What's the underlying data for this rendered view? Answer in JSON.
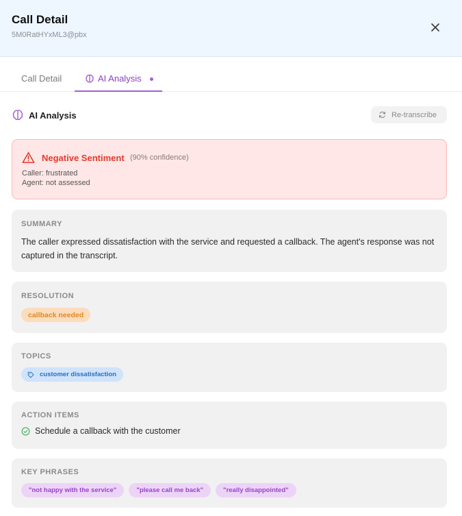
{
  "header": {
    "title": "Call Detail",
    "subtitle": "5M0RatHYxML3@pbx"
  },
  "tabs": [
    {
      "label": "Call Detail"
    },
    {
      "label": "AI Analysis"
    }
  ],
  "analysis": {
    "title": "AI Analysis",
    "retranscribe_label": "Re-transcribe"
  },
  "sentiment": {
    "title": "Negative Sentiment",
    "confidence": "(90% confidence)",
    "caller": "Caller: frustrated",
    "agent": "Agent: not assessed"
  },
  "summary": {
    "heading": "SUMMARY",
    "text": "The caller expressed dissatisfaction with the service and requested a callback. The agent's response was not captured in the transcript."
  },
  "resolution": {
    "heading": "RESOLUTION",
    "value": "callback needed"
  },
  "topics": {
    "heading": "TOPICS",
    "items": [
      "customer dissatisfaction"
    ]
  },
  "action_items": {
    "heading": "ACTION ITEMS",
    "items": [
      "Schedule a callback with the customer"
    ]
  },
  "key_phrases": {
    "heading": "KEY PHRASES",
    "items": [
      "\"not happy with the service\"",
      "\"please call me back\"",
      "\"really disappointed\""
    ]
  },
  "colors": {
    "accent_purple": "#a35fd6",
    "negative_red": "#e23b2e",
    "resolution_orange": "#e28a1e",
    "topic_blue": "#2a6fba",
    "success_green": "#3bb35a"
  }
}
